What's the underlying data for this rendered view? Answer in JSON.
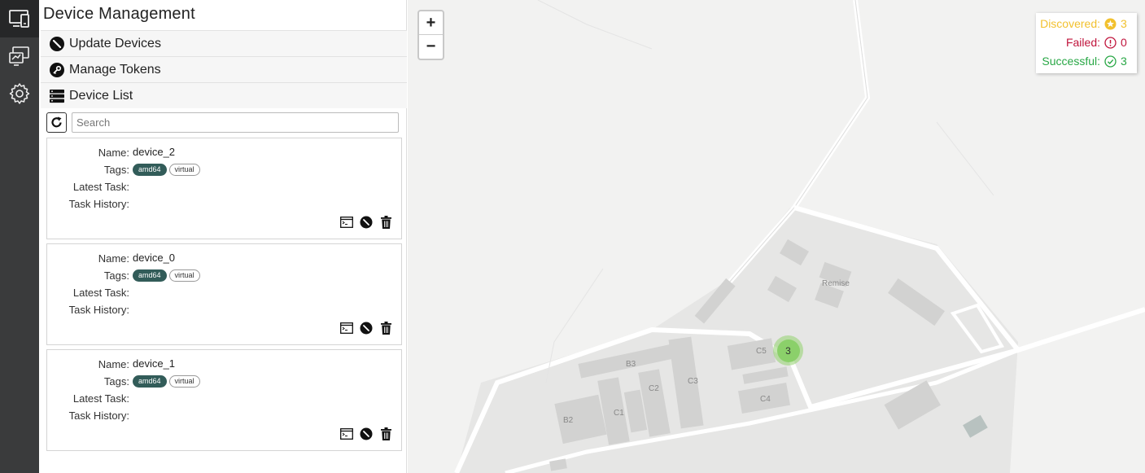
{
  "rail": {
    "items": [
      {
        "name": "devices",
        "icon": "devices-icon",
        "active": true
      },
      {
        "name": "remote",
        "icon": "monitor-chart-icon",
        "active": false
      },
      {
        "name": "settings",
        "icon": "gear-icon",
        "active": false
      }
    ]
  },
  "panel": {
    "title": "Device Management",
    "sections": {
      "update": "Update Devices",
      "tokens": "Manage Tokens",
      "list": "Device List"
    },
    "search": {
      "placeholder": "Search",
      "value": ""
    }
  },
  "labels": {
    "name": "Name:",
    "tags": "Tags:",
    "latest_task": "Latest Task:",
    "task_history": "Task History:"
  },
  "devices": [
    {
      "name": "device_2",
      "tags": [
        "amd64",
        "virtual"
      ],
      "latest_task": "",
      "task_history": ""
    },
    {
      "name": "device_0",
      "tags": [
        "amd64",
        "virtual"
      ],
      "latest_task": "",
      "task_history": ""
    },
    {
      "name": "device_1",
      "tags": [
        "amd64",
        "virtual"
      ],
      "latest_task": "",
      "task_history": ""
    }
  ],
  "map": {
    "zoom_in": "+",
    "zoom_out": "−",
    "cluster_count": "3",
    "labels": {
      "remise": "Remise",
      "b3": "B3",
      "c5": "C5",
      "c3": "C3",
      "c2": "C2",
      "c1": "C1",
      "b2": "B2",
      "c4": "C4"
    },
    "legend": {
      "discovered": {
        "label": "Discovered:",
        "count": "3",
        "color": "#f2c12e"
      },
      "failed": {
        "label": "Failed:",
        "count": "0",
        "color": "#c0143c"
      },
      "successful": {
        "label": "Successful:",
        "count": "3",
        "color": "#28a745"
      }
    }
  }
}
